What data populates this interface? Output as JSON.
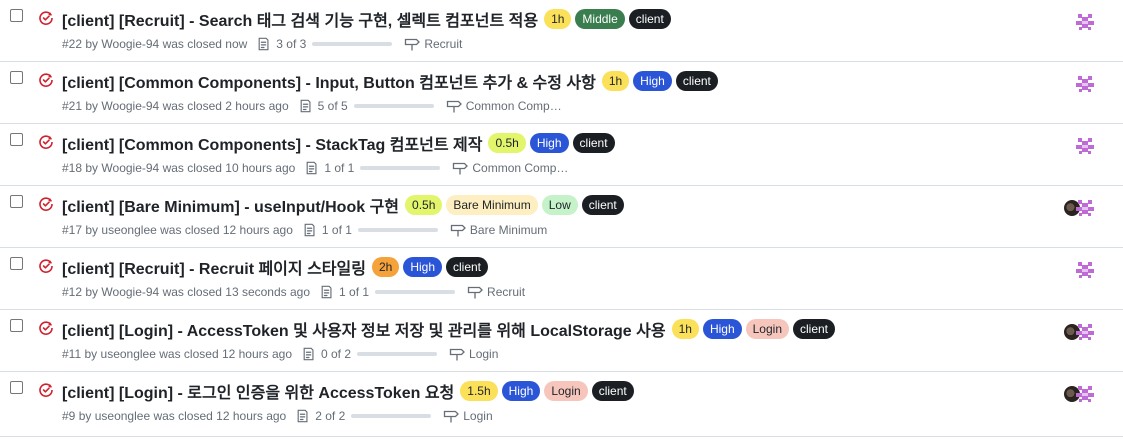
{
  "issues": [
    {
      "title": "[client] [Recruit] - Search 태그 검색 기능 구현, 셀렉트 컴포넌트 적용",
      "labels": [
        {
          "text": "1h",
          "bg": "#fbe05a",
          "fg": "#1f2328"
        },
        {
          "text": "Middle",
          "bg": "#3a7d4e",
          "fg": "#ffffff"
        },
        {
          "text": "client",
          "bg": "#1b1f24",
          "fg": "#ffffff"
        }
      ],
      "number": "#22",
      "by": "by",
      "author": "Woogie-94",
      "closed": "was closed now",
      "tasks": "3 of 3",
      "milestone": "Recruit",
      "assignees": [
        "bot"
      ]
    },
    {
      "title": "[client] [Common Components] - Input, Button 컴포넌트 추가 & 수정 사항",
      "labels": [
        {
          "text": "1h",
          "bg": "#fbe05a",
          "fg": "#1f2328"
        },
        {
          "text": "High",
          "bg": "#2a55d6",
          "fg": "#ffffff"
        },
        {
          "text": "client",
          "bg": "#1b1f24",
          "fg": "#ffffff"
        }
      ],
      "number": "#21",
      "by": "by",
      "author": "Woogie-94",
      "closed": "was closed 2 hours ago",
      "tasks": "5 of 5",
      "milestone": "Common Comp…",
      "assignees": [
        "bot"
      ]
    },
    {
      "title": "[client] [Common Components] - StackTag 컴포넌트 제작",
      "labels": [
        {
          "text": "0.5h",
          "bg": "#e2f56b",
          "fg": "#1f2328"
        },
        {
          "text": "High",
          "bg": "#2a55d6",
          "fg": "#ffffff"
        },
        {
          "text": "client",
          "bg": "#1b1f24",
          "fg": "#ffffff"
        }
      ],
      "number": "#18",
      "by": "by",
      "author": "Woogie-94",
      "closed": "was closed 10 hours ago",
      "tasks": "1 of 1",
      "milestone": "Common Comp…",
      "assignees": [
        "bot"
      ]
    },
    {
      "title": "[client] [Bare Minimum] - useInput/Hook 구현",
      "labels": [
        {
          "text": "0.5h",
          "bg": "#e2f56b",
          "fg": "#1f2328"
        },
        {
          "text": "Bare Minimum",
          "bg": "#fdefc1",
          "fg": "#1f2328"
        },
        {
          "text": "Low",
          "bg": "#c5f2c9",
          "fg": "#1f2328"
        },
        {
          "text": "client",
          "bg": "#1b1f24",
          "fg": "#ffffff"
        }
      ],
      "number": "#17",
      "by": "by",
      "author": "useonglee",
      "closed": "was closed 12 hours ago",
      "tasks": "1 of 1",
      "milestone": "Bare Minimum",
      "assignees": [
        "user",
        "bot"
      ]
    },
    {
      "title": "[client] [Recruit] - Recruit 페이지 스타일링",
      "labels": [
        {
          "text": "2h",
          "bg": "#f6a23b",
          "fg": "#1f2328"
        },
        {
          "text": "High",
          "bg": "#2a55d6",
          "fg": "#ffffff"
        },
        {
          "text": "client",
          "bg": "#1b1f24",
          "fg": "#ffffff"
        }
      ],
      "number": "#12",
      "by": "by",
      "author": "Woogie-94",
      "closed": "was closed 13 seconds ago",
      "tasks": "1 of 1",
      "milestone": "Recruit",
      "assignees": [
        "bot"
      ]
    },
    {
      "title": "[client] [Login] - AccessToken 및 사용자 정보 저장 및 관리를 위해 LocalStorage 사용",
      "labels": [
        {
          "text": "1h",
          "bg": "#fbe05a",
          "fg": "#1f2328"
        },
        {
          "text": "High",
          "bg": "#2a55d6",
          "fg": "#ffffff"
        },
        {
          "text": "Login",
          "bg": "#f6c6bd",
          "fg": "#1f2328"
        },
        {
          "text": "client",
          "bg": "#1b1f24",
          "fg": "#ffffff"
        }
      ],
      "number": "#11",
      "by": "by",
      "author": "useonglee",
      "closed": "was closed 12 hours ago",
      "tasks": "0 of 2",
      "milestone": "Login",
      "assignees": [
        "user",
        "bot"
      ]
    },
    {
      "title": "[client] [Login] - 로그인 인증을 위한 AccessToken 요청",
      "labels": [
        {
          "text": "1.5h",
          "bg": "#fbe05a",
          "fg": "#1f2328"
        },
        {
          "text": "High",
          "bg": "#2a55d6",
          "fg": "#ffffff"
        },
        {
          "text": "Login",
          "bg": "#f6c6bd",
          "fg": "#1f2328"
        },
        {
          "text": "client",
          "bg": "#1b1f24",
          "fg": "#ffffff"
        }
      ],
      "number": "#9",
      "by": "by",
      "author": "useonglee",
      "closed": "was closed 12 hours ago",
      "tasks": "2 of 2",
      "milestone": "Login",
      "assignees": [
        "user",
        "bot"
      ]
    }
  ],
  "colors": {
    "closed_icon": "#cf222e",
    "bot_avatar": "#bf6bd6",
    "muted_text": "#656d76"
  },
  "icons": {
    "state": "issue-closed-icon",
    "tasks": "tasklist-icon",
    "milestone": "milestone-icon"
  }
}
